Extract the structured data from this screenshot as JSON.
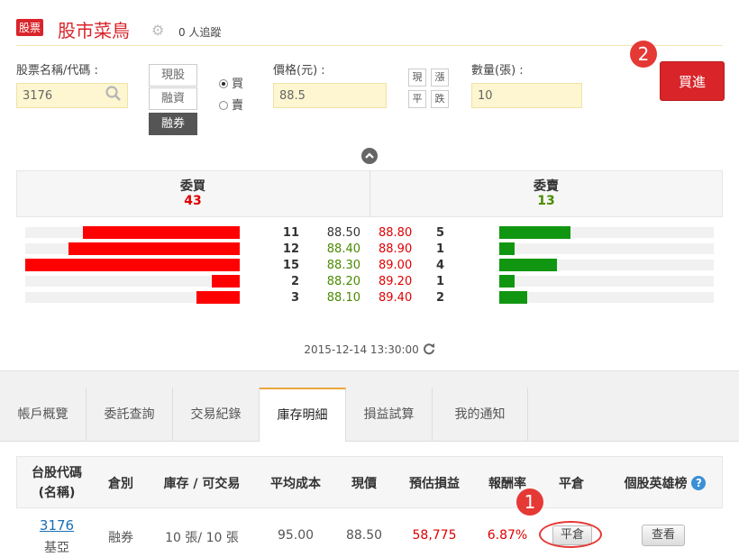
{
  "header": {
    "badge": "股票",
    "title": "股市菜鳥",
    "followers": "0 人追蹤"
  },
  "order": {
    "stock_label": "股票名稱/代碼 :",
    "stock_value": "3176",
    "modes": [
      "現股",
      "融資",
      "融券"
    ],
    "active_mode": "融券",
    "side_buy": "買",
    "side_sell": "賣",
    "price_label": "價格(元) :",
    "price_value": "88.5",
    "price_shortcuts": [
      "現",
      "漲",
      "平",
      "跌"
    ],
    "qty_label": "數量(張) :",
    "qty_value": "10",
    "submit_label": "買進"
  },
  "steps": {
    "step_buy": "2",
    "step_close": "1"
  },
  "book": {
    "bid_title": "委買",
    "bid_total": "43",
    "ask_title": "委賣",
    "ask_total": "13",
    "bids": [
      {
        "qty": "11",
        "price": "88.50",
        "bar": 0.73
      },
      {
        "qty": "12",
        "price": "88.40",
        "bar": 0.8
      },
      {
        "qty": "15",
        "price": "88.30",
        "bar": 1.0
      },
      {
        "qty": "2",
        "price": "88.20",
        "bar": 0.13
      },
      {
        "qty": "3",
        "price": "88.10",
        "bar": 0.2
      }
    ],
    "asks": [
      {
        "price": "88.80",
        "qty": "5",
        "bar": 0.33
      },
      {
        "price": "88.90",
        "qty": "1",
        "bar": 0.07
      },
      {
        "price": "89.00",
        "qty": "4",
        "bar": 0.27
      },
      {
        "price": "89.20",
        "qty": "1",
        "bar": 0.07
      },
      {
        "price": "89.40",
        "qty": "2",
        "bar": 0.13
      }
    ],
    "timestamp": "2015-12-14 13:30:00"
  },
  "tabs": [
    "帳戶概覽",
    "委託查詢",
    "交易紀錄",
    "庫存明細",
    "損益試算",
    "我的通知"
  ],
  "active_tab": "庫存明細",
  "holdings": {
    "headers": {
      "code_line1": "台股代碼",
      "code_line2": "(名稱)",
      "type": "倉別",
      "stock": "庫存 / 可交易",
      "avg_cost": "平均成本",
      "price": "現價",
      "pnl": "預估損益",
      "return": "報酬率",
      "close": "平倉",
      "hero": "個股英雄榜"
    },
    "rows": [
      {
        "code": "3176",
        "name": "基亞",
        "type": "融券",
        "stock": "10 張/ 10 張",
        "avg_cost": "95.00",
        "price": "88.50",
        "pnl": "58,775",
        "return": "6.87%",
        "close_btn": "平倉",
        "view_btn": "查看"
      }
    ]
  },
  "colors": {
    "accent_red": "#d9242a",
    "bid_bar": "#ff0000",
    "ask_bar": "#119611",
    "price_up": "#e00000",
    "price_down": "#4a8a00"
  }
}
